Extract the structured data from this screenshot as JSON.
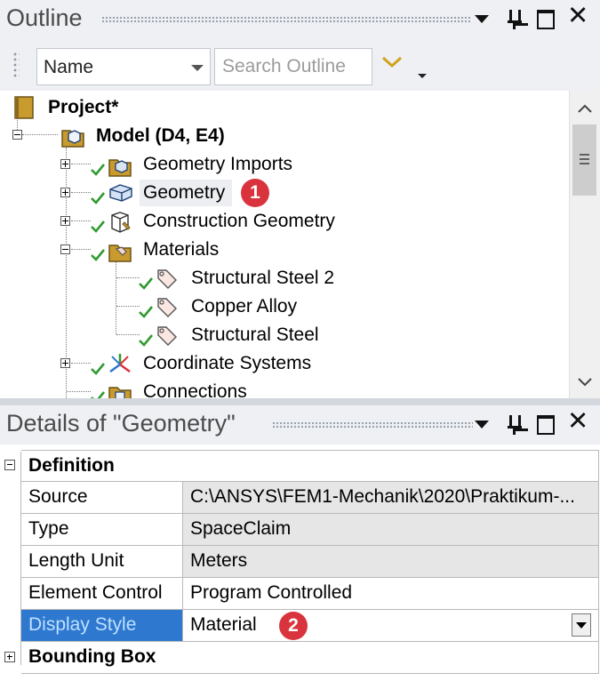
{
  "outline": {
    "title": "Outline",
    "sort_value": "Name",
    "search_placeholder": "Search Outline",
    "tree": {
      "project": "Project*",
      "model": "Model (D4, E4)",
      "geometry_imports": "Geometry Imports",
      "geometry": "Geometry",
      "construction_geometry": "Construction Geometry",
      "materials": "Materials",
      "materials_children": [
        "Structural Steel 2",
        "Copper Alloy",
        "Structural Steel"
      ],
      "coordinate_systems": "Coordinate Systems",
      "connections": "Connections"
    },
    "badge": "1"
  },
  "details": {
    "title": "Details of \"Geometry\"",
    "groups": {
      "definition": "Definition",
      "bounding_box": "Bounding Box"
    },
    "rows": [
      {
        "label": "Source",
        "value": "C:\\ANSYS\\FEM1-Mechanik\\2020\\Praktikum-..."
      },
      {
        "label": "Type",
        "value": "SpaceClaim"
      },
      {
        "label": "Length Unit",
        "value": "Meters"
      },
      {
        "label": "Element Control",
        "value": "Program Controlled"
      },
      {
        "label": "Display Style",
        "value": "Material"
      }
    ],
    "badge": "2"
  },
  "colors": {
    "accent_blue": "#2e78cf",
    "badge_red": "#d9343d",
    "check_green": "#2f9a2f",
    "folder_gold": "#c99a2e"
  },
  "icons": [
    "pin-icon",
    "maximize-icon",
    "close-icon",
    "chevron-down-icon",
    "folder-icon",
    "geometry-icon",
    "material-tag-icon",
    "coordinate-systems-icon",
    "check-icon"
  ]
}
